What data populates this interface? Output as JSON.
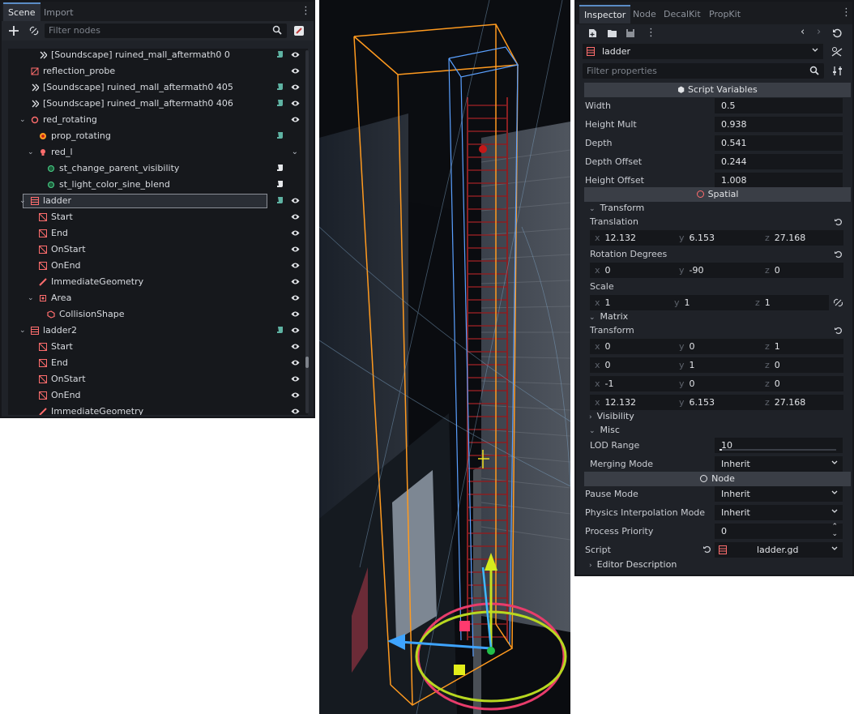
{
  "scene": {
    "tabs": [
      "Scene",
      "Import"
    ],
    "filter_placeholder": "Filter nodes",
    "rows": [
      {
        "label": "[Soundscape] ruined_mall_aftermath0 0",
        "indent": 38,
        "icon": "soundscape-icon",
        "script": true,
        "eye": true
      },
      {
        "label": "reflection_probe",
        "indent": 28,
        "icon": "reflection-probe-icon",
        "script": false,
        "eye": true
      },
      {
        "label": "[Soundscape] ruined_mall_aftermath0 405",
        "indent": 28,
        "icon": "soundscape-icon",
        "script": true,
        "eye": true
      },
      {
        "label": "[Soundscape] ruined_mall_aftermath0 406",
        "indent": 28,
        "icon": "soundscape-icon",
        "script": true,
        "eye": true
      },
      {
        "label": "red_rotating",
        "indent": 28,
        "icon": "spatial-icon",
        "script": false,
        "eye": true,
        "expand": true
      },
      {
        "label": "prop_rotating",
        "indent": 38,
        "icon": "prop-icon",
        "script": true,
        "eye": false
      },
      {
        "label": "red_l",
        "indent": 38,
        "icon": "light-icon",
        "script": false,
        "eye": false,
        "expand": true,
        "collapse_mark": true
      },
      {
        "label": "st_change_parent_visibility",
        "indent": 48,
        "icon": "node-dot-icon",
        "script": true,
        "eye": false,
        "white_script": true
      },
      {
        "label": "st_light_color_sine_blend",
        "indent": 48,
        "icon": "node-dot-icon",
        "script": true,
        "eye": false,
        "white_script": true
      },
      {
        "label": "ladder",
        "indent": 28,
        "icon": "ladder-icon",
        "script": true,
        "eye": true,
        "expand": true,
        "selected": true
      },
      {
        "label": "Start",
        "indent": 38,
        "icon": "position-icon",
        "script": false,
        "eye": true
      },
      {
        "label": "End",
        "indent": 38,
        "icon": "position-icon",
        "script": false,
        "eye": true
      },
      {
        "label": "OnStart",
        "indent": 38,
        "icon": "position-icon",
        "script": false,
        "eye": true
      },
      {
        "label": "OnEnd",
        "indent": 38,
        "icon": "position-icon",
        "script": false,
        "eye": true
      },
      {
        "label": "ImmediateGeometry",
        "indent": 38,
        "icon": "geometry-icon",
        "script": false,
        "eye": true
      },
      {
        "label": "Area",
        "indent": 38,
        "icon": "area-icon",
        "script": false,
        "eye": true,
        "expand": true
      },
      {
        "label": "CollisionShape",
        "indent": 48,
        "icon": "collision-shape-icon",
        "script": false,
        "eye": true
      },
      {
        "label": "ladder2",
        "indent": 28,
        "icon": "ladder-icon",
        "script": true,
        "eye": true,
        "expand": true
      },
      {
        "label": "Start",
        "indent": 38,
        "icon": "position-icon",
        "script": false,
        "eye": true
      },
      {
        "label": "End",
        "indent": 38,
        "icon": "position-icon",
        "script": false,
        "eye": true
      },
      {
        "label": "OnStart",
        "indent": 38,
        "icon": "position-icon",
        "script": false,
        "eye": true
      },
      {
        "label": "OnEnd",
        "indent": 38,
        "icon": "position-icon",
        "script": false,
        "eye": true
      },
      {
        "label": "ImmediateGeometry",
        "indent": 38,
        "icon": "geometry-icon",
        "script": false,
        "eye": true
      }
    ]
  },
  "inspector": {
    "tabs": [
      "Inspector",
      "Node",
      "DecalKit",
      "PropKit"
    ],
    "object_name": "ladder",
    "filter_placeholder": "Filter properties",
    "script_variables_title": "Script Variables",
    "script_variables": [
      {
        "label": "Width",
        "value": "0.5"
      },
      {
        "label": "Height Mult",
        "value": "0.938"
      },
      {
        "label": "Depth",
        "value": "0.541"
      },
      {
        "label": "Depth Offset",
        "value": "0.244"
      },
      {
        "label": "Height Offset",
        "value": "1.008"
      }
    ],
    "spatial_title": "Spatial",
    "transform_group": "Transform",
    "translation_label": "Translation",
    "translation": {
      "x": "12.132",
      "y": "6.153",
      "z": "27.168"
    },
    "rotation_label": "Rotation Degrees",
    "rotation": {
      "x": "0",
      "y": "-90",
      "z": "0"
    },
    "scale_label": "Scale",
    "scale": {
      "x": "1",
      "y": "1",
      "z": "1"
    },
    "matrix_group": "Matrix",
    "matrix_label": "Transform",
    "matrix": [
      {
        "x": "0",
        "y": "0",
        "z": "1"
      },
      {
        "x": "0",
        "y": "1",
        "z": "0"
      },
      {
        "x": "-1",
        "y": "0",
        "z": "0"
      },
      {
        "x": "12.132",
        "y": "6.153",
        "z": "27.168"
      }
    ],
    "visibility_group": "Visibility",
    "misc_group": "Misc",
    "lod_label": "LOD Range",
    "lod_value": "10",
    "merging_label": "Merging Mode",
    "merging_value": "Inherit",
    "node_title": "Node",
    "pause_label": "Pause Mode",
    "pause_value": "Inherit",
    "physics_label": "Physics Interpolation Mode",
    "physics_value": "Inherit",
    "priority_label": "Process Priority",
    "priority_value": "0",
    "script_label": "Script",
    "script_value": "ladder.gd",
    "editor_desc_group": "Editor Description"
  },
  "axis_letters": {
    "x": "x",
    "y": "y",
    "z": "z"
  },
  "colors": {
    "accent": "#5b8cc6",
    "node_red": "#ff6d6d",
    "script_teal": "#5fb3a3",
    "orange_gizmo": "#ff9a1f",
    "blue_gizmo": "#5aa0ff"
  }
}
